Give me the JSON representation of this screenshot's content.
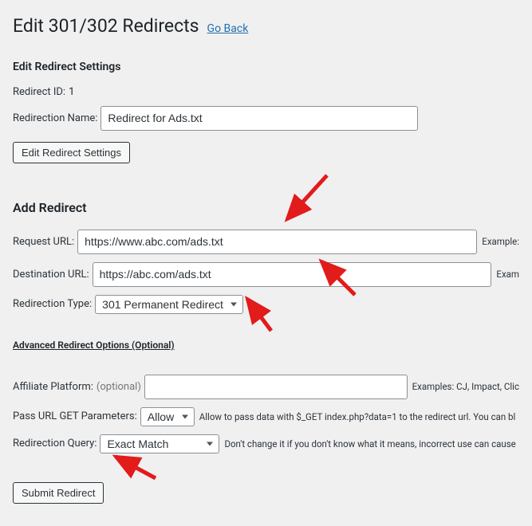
{
  "page": {
    "title": "Edit 301/302 Redirects",
    "go_back": "Go Back"
  },
  "edit_settings": {
    "heading": "Edit Redirect Settings",
    "id_label": "Redirect ID:",
    "id_value": "1",
    "name_label": "Redirection Name:",
    "name_value": "Redirect for Ads.txt",
    "button": "Edit Redirect Settings"
  },
  "add_redirect": {
    "heading": "Add Redirect",
    "request_label": "Request URL:",
    "request_value": "https://www.abc.com/ads.txt",
    "request_hint": "Example:",
    "dest_label": "Destination URL:",
    "dest_value": "https://abc.com/ads.txt",
    "dest_hint": "Exam",
    "type_label": "Redirection Type:",
    "type_value": "301 Permanent Redirect"
  },
  "advanced": {
    "heading": "Advanced Redirect Options (Optional)",
    "affiliate_label": "Affiliate Platform:",
    "affiliate_optional": "(optional)",
    "affiliate_value": "",
    "affiliate_hint": "Examples: CJ, Impact, Clic",
    "pass_get_label": "Pass URL GET Parameters:",
    "pass_get_value": "Allow",
    "pass_get_hint": "Allow to pass data with $_GET index.php?data=1 to the redirect url. You can bl",
    "query_label": "Redirection Query:",
    "query_value": "Exact Match",
    "query_hint": "Don't change it if you don't know what it means, incorrect use can cause"
  },
  "submit": {
    "button": "Submit Redirect"
  }
}
